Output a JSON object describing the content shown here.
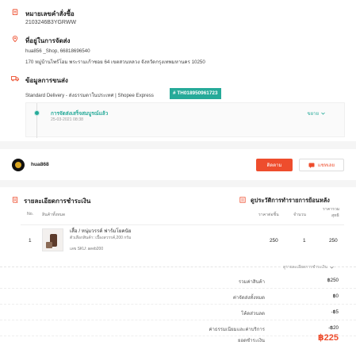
{
  "order": {
    "order_no_label": "หมายเลขคำสั่งซื้อ",
    "order_no": "2103246B3YGRWW"
  },
  "address": {
    "title": "ที่อยู่ในการจัดส่ง",
    "name_line": "hua856 _Shop, 66818696540",
    "address_line": "170 หมู่บ้านไพร์โฮม พระรามเก้าซอย 64 เขตสวนหลวง จังหวัดกรุงเทพมหานคร 10250"
  },
  "shipping": {
    "title": "ข้อมูลการขนส่ง",
    "carrier_line": "Standard Delivery - ส่งธรรมดาในประเทศ | Shopee Express",
    "tracking": "# TH018950961723",
    "status": "การจัดส่งเสร็จสมบูรณ์แล้ว",
    "status_time": "25-03-2021 08:38",
    "expand_label": "ขยาย"
  },
  "shop": {
    "name": "hua868",
    "chat_label": "ติดตาม",
    "report_label": "แชทเลย"
  },
  "payment": {
    "title": "รายละเอียดการชำระเงิน",
    "history_label": "ดูประวัติการทำรายการย้อนหลัง",
    "columns": {
      "no": "No.",
      "product": "สินค้าทั้งหมด",
      "unit_price": "ราคาต่อชิ้น",
      "qty": "จำนวน",
      "subtotal_top": "ราคารวม",
      "subtotal_bottom": "สุทธิ"
    },
    "item": {
      "no": "1",
      "name": "เสื้อ / หนุ่มวรรค์ ฟาร์มโยคนัย",
      "variation": "ตัวเลือกสินค้า: เบื้องสวรรค์,200 กรัม",
      "sku": "เลข SKU: aeeb200",
      "unit_price": "250",
      "qty": "1",
      "subtotal": "250"
    },
    "details_toggle": "ดูรายละเอียดการชำระเงิน",
    "summary": [
      {
        "label": "รวมค่าสินค้า",
        "value": "฿250"
      },
      {
        "label": "ค่าจัดส่งทั้งหมด",
        "value": "฿0"
      },
      {
        "label": "โค้ดส่วนลด",
        "value": "-฿5"
      },
      {
        "label": "ค่าธรรมเนียมและค่าบริการ",
        "value": "-฿20"
      }
    ],
    "total_label": "ยอดชำระเงิน",
    "total_value": "฿225"
  },
  "colors": {
    "accent": "#ee4d2d",
    "teal": "#26aa99"
  }
}
